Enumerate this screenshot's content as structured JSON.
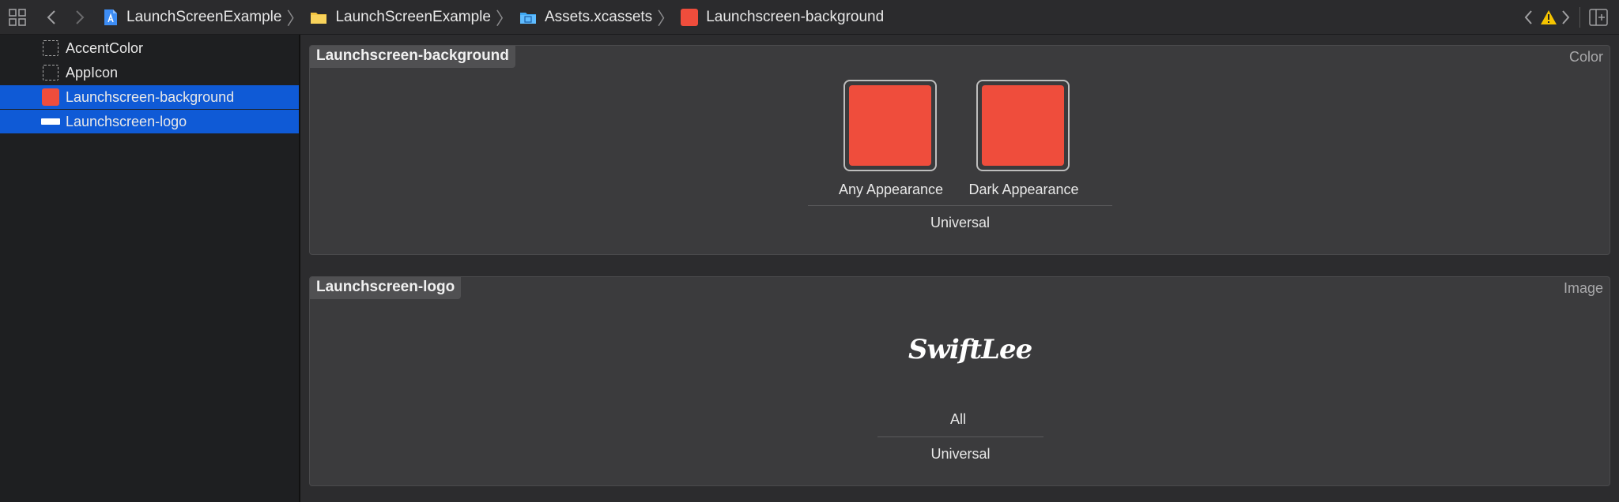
{
  "breadcrumbs": [
    {
      "label": "LaunchScreenExample",
      "icon": "xcode-project-icon"
    },
    {
      "label": "LaunchScreenExample",
      "icon": "folder-icon"
    },
    {
      "label": "Assets.xcassets",
      "icon": "asset-catalog-icon"
    },
    {
      "label": "Launchscreen-background",
      "icon": "color-set-icon"
    }
  ],
  "sidebar": {
    "items": [
      {
        "label": "AccentColor",
        "icon": "color-set-placeholder-icon",
        "selected": false
      },
      {
        "label": "AppIcon",
        "icon": "app-icon-placeholder-icon",
        "selected": false
      },
      {
        "label": "Launchscreen-background",
        "icon": "color-swatch-icon",
        "selected": true
      },
      {
        "label": "Launchscreen-logo",
        "icon": "image-set-icon",
        "selected": true
      }
    ]
  },
  "panels": {
    "background": {
      "title": "Launchscreen-background",
      "type": "Color",
      "swatches": [
        {
          "caption": "Any Appearance",
          "color": "#ef4d3c"
        },
        {
          "caption": "Dark Appearance",
          "color": "#ef4d3c"
        }
      ],
      "footer": "Universal"
    },
    "logo": {
      "title": "Launchscreen-logo",
      "type": "Image",
      "logo_text": "SwiftLee",
      "caption": "All",
      "footer": "Universal"
    }
  },
  "colors": {
    "selection": "#0f5ad6",
    "swatch_red": "#ef4d3c",
    "warning": "#f5c400"
  }
}
